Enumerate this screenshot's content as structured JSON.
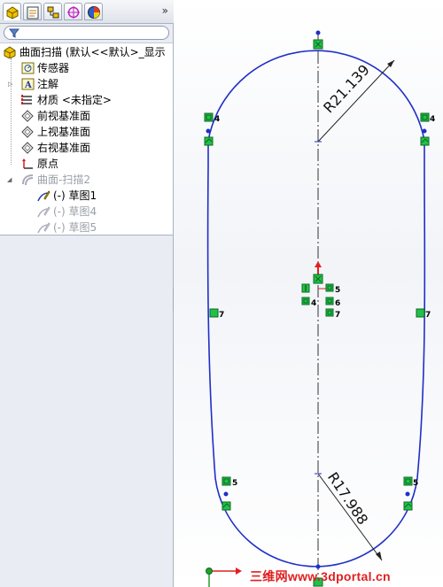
{
  "tabs": [
    {
      "name": "FeatureManager",
      "icon": "feature-manager-icon"
    },
    {
      "name": "PropertyManager",
      "icon": "property-manager-icon"
    },
    {
      "name": "ConfigurationManager",
      "icon": "configuration-manager-icon"
    },
    {
      "name": "DimXpertManager",
      "icon": "dimxpert-icon"
    },
    {
      "name": "DisplayManager",
      "icon": "display-manager-icon"
    }
  ],
  "expand_symbol": "»",
  "tree": {
    "root": "曲面扫描  (默认<<默认>_显示",
    "items": [
      {
        "label": "传感器",
        "icon": "sensor-icon"
      },
      {
        "label": "注解",
        "icon": "annotation-icon"
      },
      {
        "label": "材质 <未指定>",
        "icon": "material-icon"
      },
      {
        "label": "前视基准面",
        "icon": "plane-icon"
      },
      {
        "label": "上视基准面",
        "icon": "plane-icon"
      },
      {
        "label": "右视基准面",
        "icon": "plane-icon"
      },
      {
        "label": "原点",
        "icon": "origin-icon"
      },
      {
        "label": "曲面-扫描2",
        "icon": "surface-sweep-icon"
      },
      {
        "label": "(-) 草图1",
        "icon": "sketch-icon"
      },
      {
        "label": "(-) 草图4",
        "icon": "sketch-icon"
      },
      {
        "label": "(-) 草图5",
        "icon": "sketch-icon"
      }
    ]
  },
  "sketch": {
    "dimensions": {
      "upper_radius": "R21.139",
      "lower_radius": "R17.988"
    },
    "relation_badges": [
      "4",
      "4",
      "5",
      "6",
      "4",
      "7",
      "7",
      "7",
      "7",
      "5",
      "5"
    ],
    "colors": {
      "curve": "#1f2fc8",
      "centerline": "#333333",
      "relation_fill": "#22c04a",
      "relation_border": "#0b6a1f"
    }
  },
  "watermark": "三维网www.3dportal.cn",
  "colors": {
    "panel": "#e9ecf2",
    "watermark": "#e02020"
  }
}
